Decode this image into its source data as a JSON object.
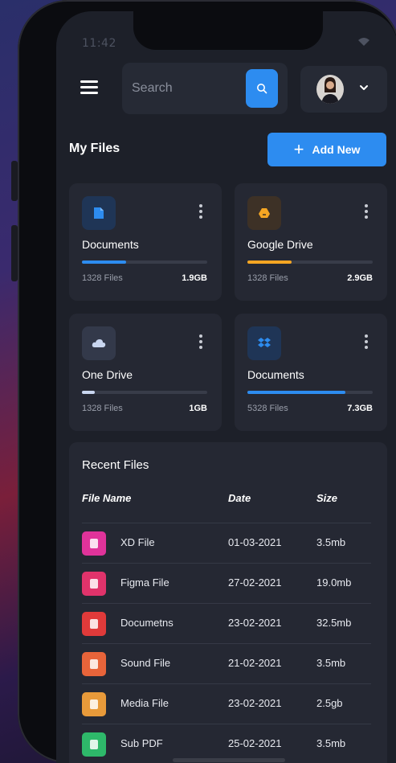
{
  "status": {
    "time": "11:42"
  },
  "search": {
    "placeholder": "Search"
  },
  "header": {
    "title": "My Files",
    "add_label": "Add New"
  },
  "storage_cards": [
    {
      "name": "Documents",
      "count": "1328 Files",
      "size": "1.9GB",
      "progress": 0.35,
      "color": "#2d8cf0",
      "icon": "document-icon",
      "icon_bg": "#1f3556"
    },
    {
      "name": "Google Drive",
      "count": "1328 Files",
      "size": "2.9GB",
      "progress": 0.35,
      "color": "#f5a623",
      "icon": "google-drive-icon",
      "icon_bg": "#3d3126"
    },
    {
      "name": "One Drive",
      "count": "1328 Files",
      "size": "1GB",
      "progress": 0.1,
      "color": "#c9d6f0",
      "icon": "cloud-icon",
      "icon_bg": "#33394a"
    },
    {
      "name": "Documents",
      "count": "5328 Files",
      "size": "7.3GB",
      "progress": 0.78,
      "color": "#2d8cf0",
      "icon": "dropbox-icon",
      "icon_bg": "#1f3556"
    }
  ],
  "recent": {
    "title": "Recent Files",
    "headers": {
      "name": "File Name",
      "date": "Date",
      "size": "Size"
    },
    "rows": [
      {
        "name": "XD File",
        "date": "01-03-2021",
        "size": "3.5mb",
        "color": "#e0339a",
        "icon": "xd-file-icon"
      },
      {
        "name": "Figma File",
        "date": "27-02-2021",
        "size": "19.0mb",
        "color": "#e0336b",
        "icon": "figma-file-icon"
      },
      {
        "name": "Documetns",
        "date": "23-02-2021",
        "size": "32.5mb",
        "color": "#e03a3a",
        "icon": "document-file-icon"
      },
      {
        "name": "Sound File",
        "date": "21-02-2021",
        "size": "3.5mb",
        "color": "#e8643a",
        "icon": "sound-file-icon"
      },
      {
        "name": "Media File",
        "date": "23-02-2021",
        "size": "2.5gb",
        "color": "#e89a3a",
        "icon": "media-file-icon"
      },
      {
        "name": "Sub PDF",
        "date": "25-02-2021",
        "size": "3.5mb",
        "color": "#2eb86a",
        "icon": "pdf-file-icon"
      }
    ]
  }
}
